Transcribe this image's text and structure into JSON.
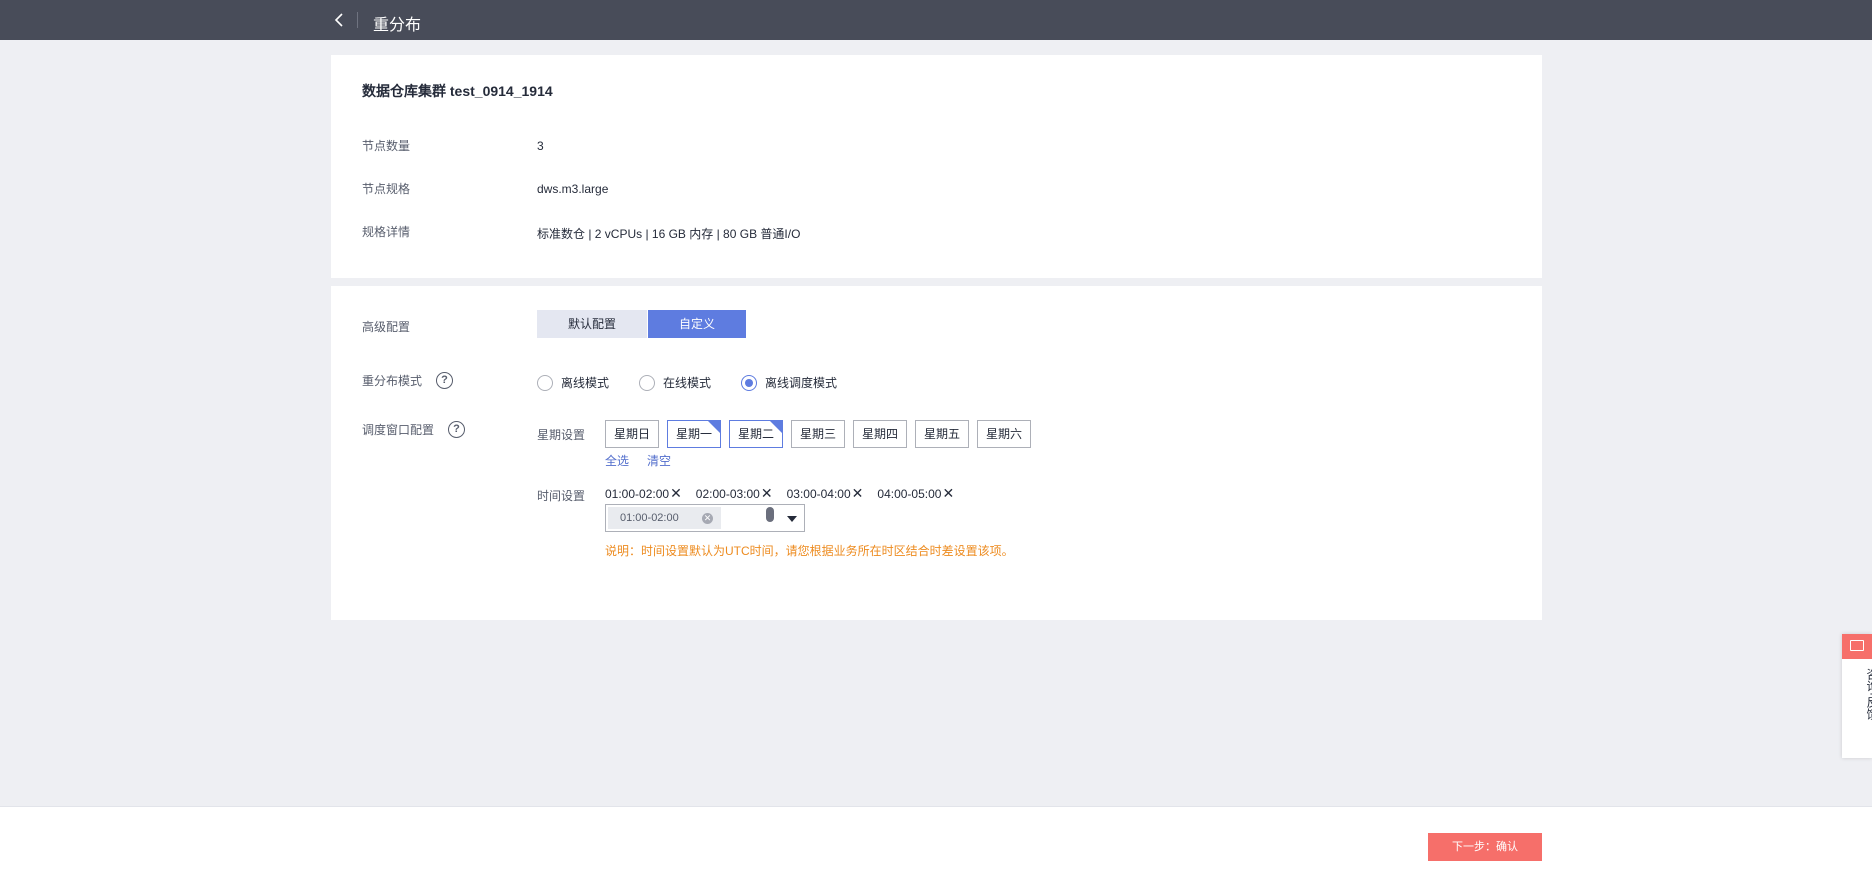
{
  "header": {
    "title": "重分布"
  },
  "cluster": {
    "title": "数据仓库集群 test_0914_1914",
    "fields": [
      {
        "label": "节点数量",
        "value": "3"
      },
      {
        "label": "节点规格",
        "value": "dws.m3.large"
      },
      {
        "label": "规格详情",
        "value": "标准数仓 | 2 vCPUs | 16 GB 内存 | 80 GB 普通I/O"
      }
    ]
  },
  "advanced": {
    "label": "高级配置",
    "options": [
      "默认配置",
      "自定义"
    ],
    "selected": "自定义"
  },
  "mode": {
    "label": "重分布模式",
    "options": [
      "离线模式",
      "在线模式",
      "离线调度模式"
    ],
    "selected": "离线调度模式"
  },
  "schedule": {
    "label": "调度窗口配置",
    "week_label": "星期设置",
    "days": [
      "星期日",
      "星期一",
      "星期二",
      "星期三",
      "星期四",
      "星期五",
      "星期六"
    ],
    "selected_days": [
      "星期一",
      "星期二"
    ],
    "select_all": "全选",
    "clear": "清空",
    "time_label": "时间设置",
    "time_tags": [
      "01:00-02:00",
      "02:00-03:00",
      "03:00-04:00",
      "04:00-05:00"
    ],
    "select_chip": "01:00-02:00",
    "note": "说明：时间设置默认为UTC时间，请您根据业务所在时区结合时差设置该项。"
  },
  "footer": {
    "next_label": "下一步：确认"
  },
  "side": {
    "feedback_label": "咨询·反馈"
  },
  "colors": {
    "topbar": "#484c59",
    "accent": "#5e7ce0",
    "primary_button": "#f66f6a",
    "note": "#ed8b1f"
  }
}
